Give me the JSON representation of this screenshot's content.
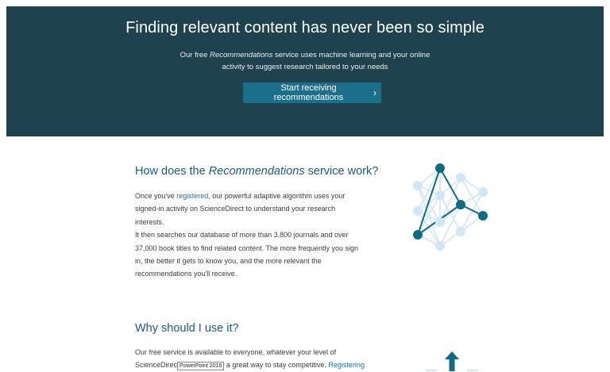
{
  "hero": {
    "title": "Finding relevant content has never been so simple",
    "desc_line1_before": "Our free ",
    "desc_line1_em": "Recommendations",
    "desc_line1_after": " service uses machine learning and your online",
    "desc_line2": "activity to suggest research tailored to your needs",
    "cta_label": "Start receiving recommendations",
    "cta_icon": "chevron-right-icon"
  },
  "how": {
    "title_before": "How does the ",
    "title_em": "Recommendations",
    "title_after": " service work?",
    "p_before_link": "Once you've ",
    "link": "registered",
    "p_line1_after": ", our powerful adaptive algorithm uses your",
    "p_line2": "signed-in activity on ScienceDirect to understand your research interests.",
    "p_line3": "It then searches our database of more than 3,800 journals and over",
    "p_line4": "37,000 book titles to find related content. The more frequently you sign",
    "p_line5": "in, the better it gets to know you, and the more relevant the",
    "p_line6": "recommendations you'll receive.",
    "illustration_icon": "neural-network-icon"
  },
  "why": {
    "title": "Why should I use it?",
    "p_line1": "Our free service is available to everyone, whatever your level of",
    "p_line2_before": "ScienceDirec",
    "tooltip": "PowerPoint 2016",
    "p_line2_after": " a great way to stay competitive. ",
    "p_line2_link": "Registering",
    "illustration_icon": "arrow-up-icon"
  },
  "colors": {
    "hero_bg": "#1f434e",
    "cta_bg": "#1b6f8a",
    "heading": "#1b5a7a",
    "link": "#1b6f9e",
    "node_dark": "#0e6b88",
    "node_light": "#cfe6f5"
  }
}
